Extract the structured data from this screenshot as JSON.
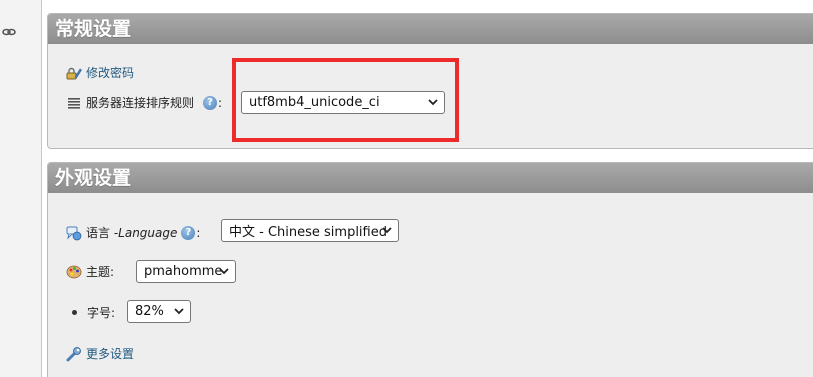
{
  "sidebar": {
    "link_icon": "chain-link-icon"
  },
  "general_settings": {
    "title": "常规设置",
    "change_password": {
      "icon": "password-edit-icon",
      "label": "修改密码"
    },
    "collation": {
      "icon": "list-icon",
      "label": "服务器连接排序规则",
      "help_icon": "help-icon",
      "colon": ":",
      "selected": "utf8mb4_unicode_ci"
    }
  },
  "appearance_settings": {
    "title": "外观设置",
    "language": {
      "icon": "language-icon",
      "label": "语言 - ",
      "label_italic": "Language",
      "help_icon": "help-icon",
      "colon": ":",
      "selected": "中文 - Chinese simplified"
    },
    "theme": {
      "icon": "palette-icon",
      "label": "主题:",
      "selected": "pmahomme"
    },
    "font_size": {
      "label": "字号:",
      "selected": "82%"
    },
    "more_settings": {
      "icon": "wrench-icon",
      "label": "更多设置"
    }
  },
  "colors": {
    "highlight": "#ee2b2b",
    "link": "#235a81",
    "panel_header": "#9a9a9a"
  }
}
